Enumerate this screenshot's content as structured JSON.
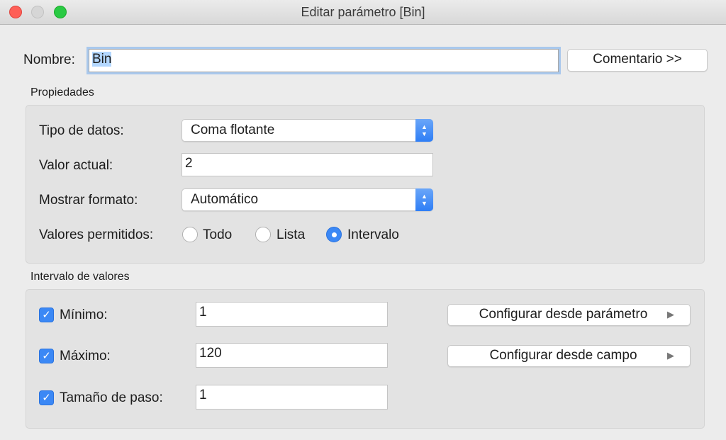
{
  "window": {
    "title": "Editar parámetro [Bin]"
  },
  "name": {
    "label": "Nombre:",
    "value": "Bin"
  },
  "comment_button": "Comentario >>",
  "properties": {
    "heading": "Propiedades",
    "data_type_label": "Tipo de datos:",
    "data_type_value": "Coma flotante",
    "current_value_label": "Valor actual:",
    "current_value": "2",
    "display_format_label": "Mostrar formato:",
    "display_format_value": "Automático",
    "allowed_values_label": "Valores permitidos:",
    "allowed_options": [
      "Todo",
      "Lista",
      "Intervalo"
    ],
    "allowed_selected": "Intervalo"
  },
  "range": {
    "heading": "Intervalo de valores",
    "min": {
      "label": "Mínimo:",
      "value": "1",
      "checked": true
    },
    "max": {
      "label": "Máximo:",
      "value": "120",
      "checked": true
    },
    "step": {
      "label": "Tamaño de paso:",
      "value": "1",
      "checked": true
    },
    "set_from_parameter": "Configurar desde parámetro",
    "set_from_field": "Configurar desde campo"
  },
  "colors": {
    "accent": "#3b88f5",
    "selection": "#b3d7ff"
  }
}
